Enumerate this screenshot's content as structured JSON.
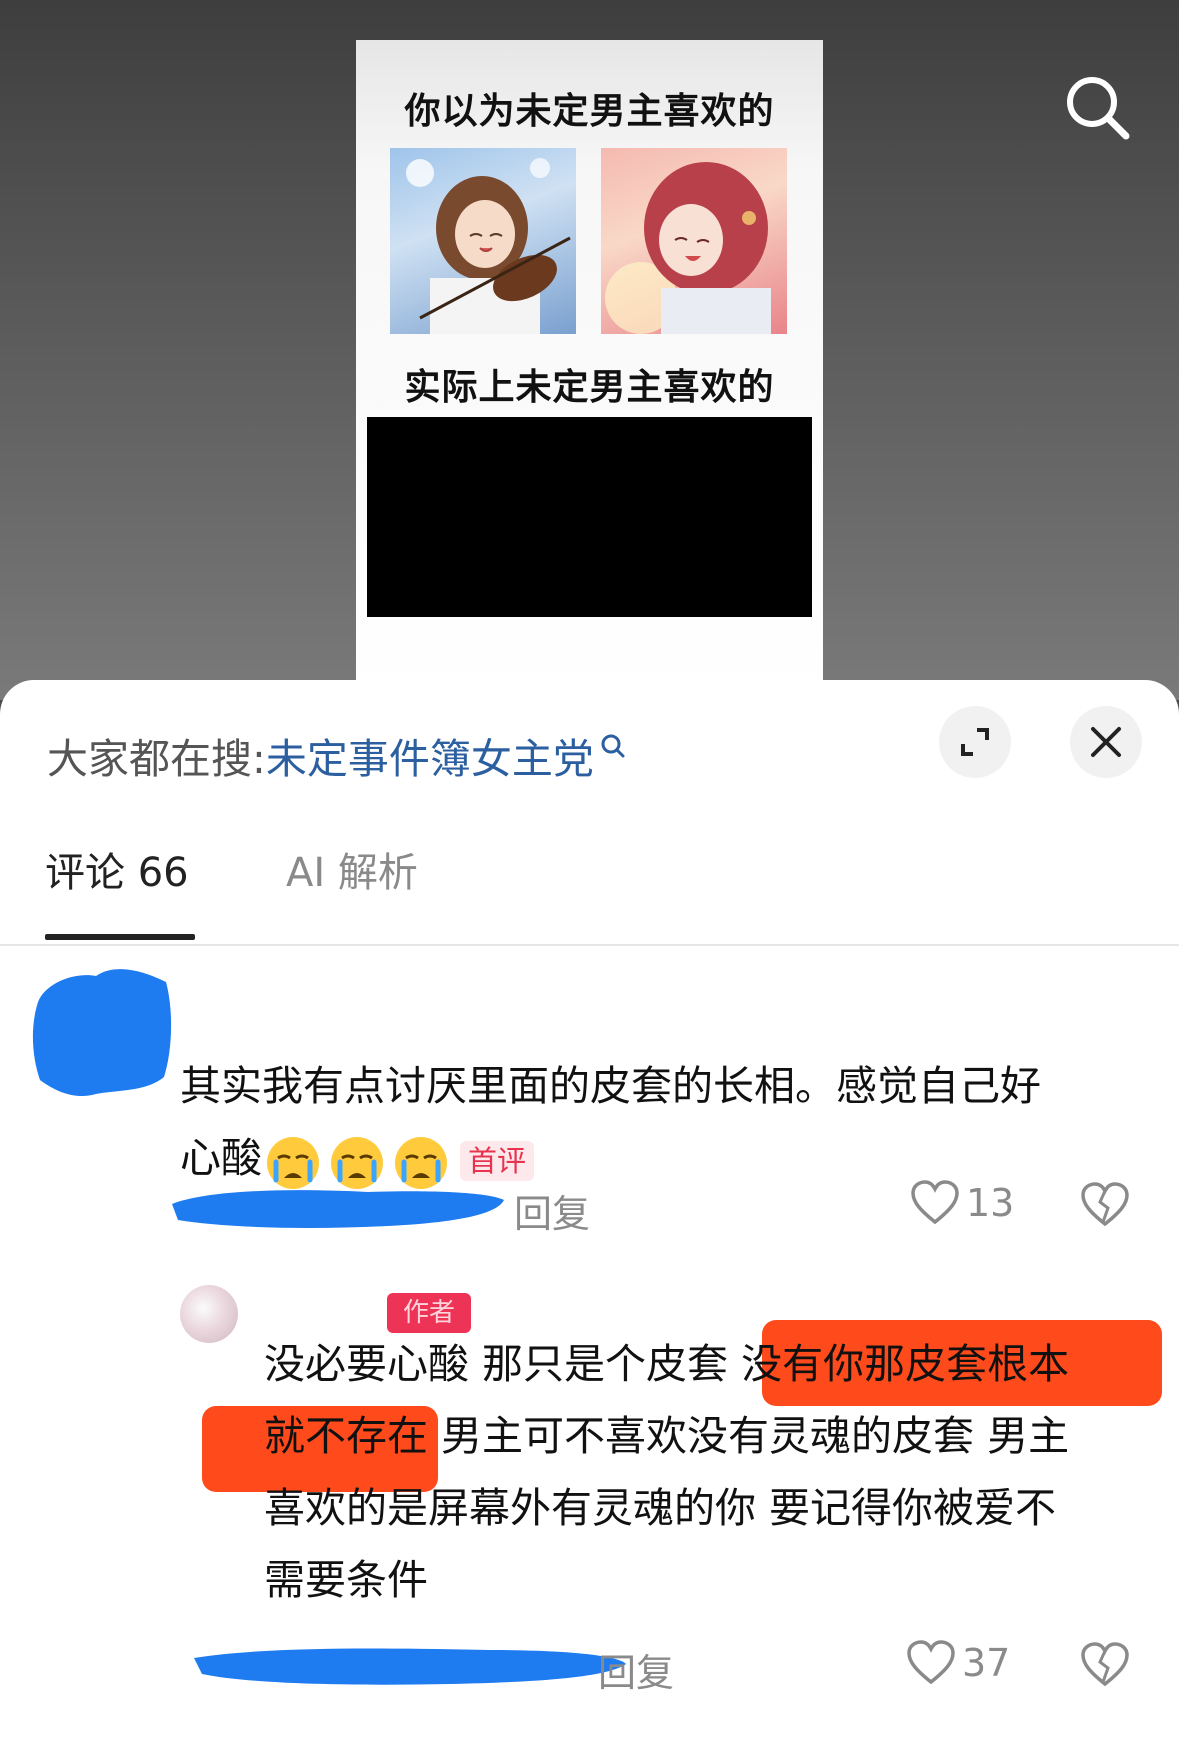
{
  "meme": {
    "caption_top": "你以为未定男主喜欢的",
    "caption_mid": "实际上未定男主喜欢的"
  },
  "hot_search": {
    "prefix": "大家都在搜:",
    "link": "未定事件簿女主党"
  },
  "tabs": {
    "comments": "评论 66",
    "ai": "AI 解析"
  },
  "comments": [
    {
      "text_line1": "其实我有点讨厌里面的皮套的长相。感觉自己好",
      "text_line2": "心酸",
      "badge": "首评",
      "reply": "回复",
      "likes": "13"
    },
    {
      "author_badge": "作者",
      "text_plain_1": "没必要心酸 那只是个皮套 ",
      "text_hl_1": "没有你那皮套根本",
      "text_hl_2": "就不存在",
      "text_plain_2": " 男主可不喜欢没有灵魂的皮套 男主",
      "text_line3": "喜欢的是屏幕外有灵魂的你 要记得你被爱不",
      "text_line4": "需要条件",
      "reply": "回复",
      "likes": "37"
    }
  ],
  "colors": {
    "link": "#2c5fa0",
    "badge_red": "#e8334f",
    "highlight": "#ff4a1c",
    "redaction_blue": "#1e7bf0"
  }
}
